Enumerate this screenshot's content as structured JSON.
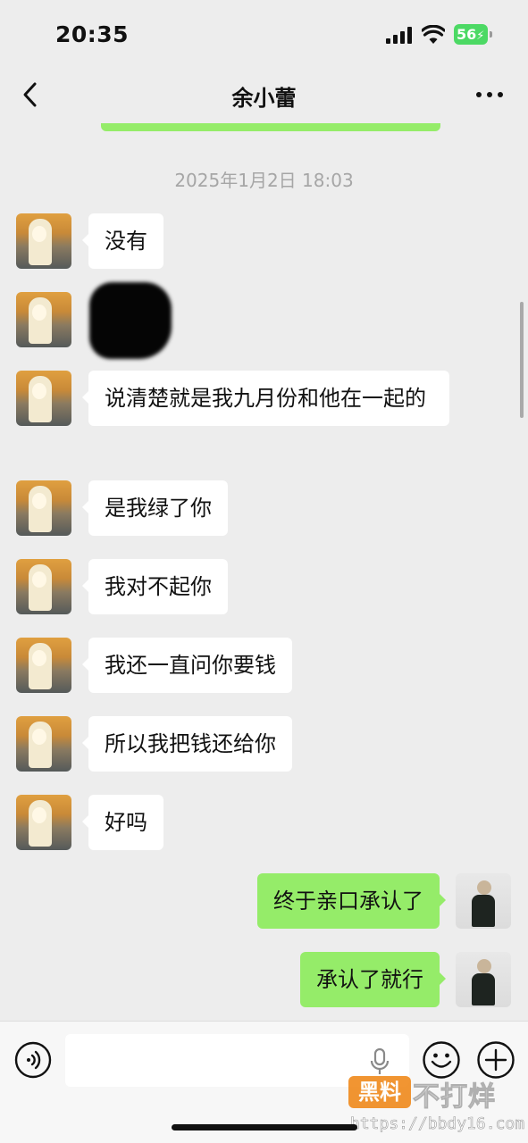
{
  "status_bar": {
    "time": "20:35",
    "battery": "56"
  },
  "nav": {
    "title": "余小蕾"
  },
  "chat": {
    "timestamp": "2025年1月2日 18:03",
    "messages": [
      {
        "side": "in",
        "text": "没有"
      },
      {
        "side": "in",
        "text": "",
        "redacted": true
      },
      {
        "side": "in",
        "text": "说清楚就是我九月份和他在一起的"
      },
      {
        "side": "in",
        "text": "是我绿了你"
      },
      {
        "side": "in",
        "text": "我对不起你"
      },
      {
        "side": "in",
        "text": "我还一直问你要钱"
      },
      {
        "side": "in",
        "text": "所以我把钱还给你"
      },
      {
        "side": "in",
        "text": "好吗"
      },
      {
        "side": "out",
        "text": "终于亲口承认了"
      },
      {
        "side": "out",
        "text": "承认了就行"
      }
    ]
  },
  "input": {
    "value": ""
  },
  "watermark": {
    "badge": "黑料",
    "text": "不打烊",
    "url": "https://bbdy16.com"
  },
  "colors": {
    "background": "#ededed",
    "incoming_bubble": "#ffffff",
    "outgoing_bubble": "#95ec69",
    "battery": "#4cd964"
  }
}
